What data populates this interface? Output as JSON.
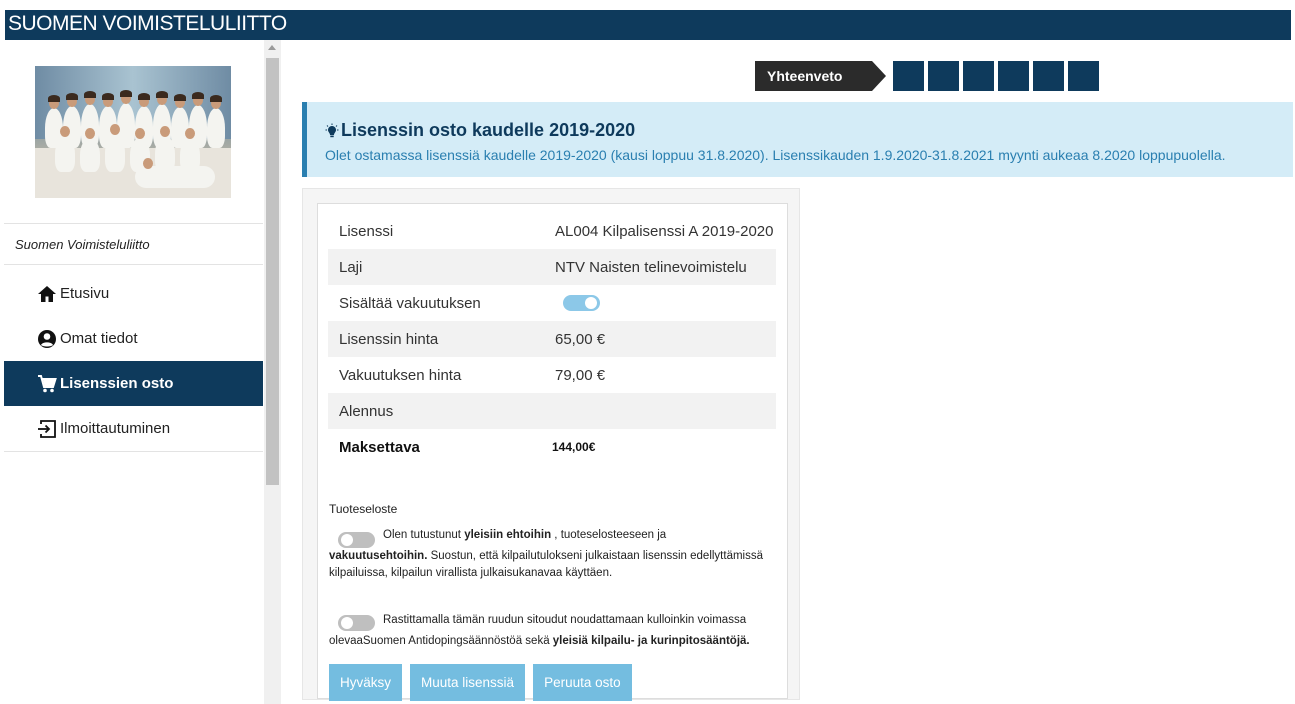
{
  "header": {
    "title": "SUOMEN VOIMISTELULIITTO"
  },
  "sidebar": {
    "org_name": "Suomen Voimisteluliitto",
    "items": [
      {
        "label": "Etusivu",
        "icon": "home-icon",
        "active": false
      },
      {
        "label": "Omat tiedot",
        "icon": "user-circle-icon",
        "active": false
      },
      {
        "label": "Lisenssien osto",
        "icon": "cart-icon",
        "active": true
      },
      {
        "label": "Ilmoittautuminen",
        "icon": "sign-in-icon",
        "active": false
      }
    ]
  },
  "steps": {
    "current": "Yhteenveto",
    "remaining_count": 6
  },
  "alert": {
    "title": "Lisenssin osto kaudelle 2019-2020",
    "message": "Olet ostamassa lisenssiä kaudelle 2019-2020 (kausi loppuu 31.8.2020). Lisenssikauden 1.9.2020-31.8.2021 myynti aukeaa 8.2020 loppupuolella."
  },
  "summary": {
    "rows": [
      {
        "label": "Lisenssi",
        "value": "AL004 Kilpalisenssi A 2019-2020"
      },
      {
        "label": "Laji",
        "value": "NTV Naisten telinevoimistelu"
      },
      {
        "label": "Sisältää vakuutuksen",
        "toggle": true
      },
      {
        "label": "Lisenssin hinta",
        "value": "65,00 €"
      },
      {
        "label": "Vakuutuksen hinta",
        "value": "79,00 €"
      },
      {
        "label": "Alennus",
        "value": ""
      },
      {
        "label": "Maksettava",
        "value": "144,00€"
      }
    ]
  },
  "terms": {
    "heading": "Tuoteseloste",
    "t1_pre": "Olen tutustunut ",
    "t1_link1": "yleisiin ehtoihin",
    "t1_mid": " , tuoteselosteeseen ja",
    "t1_link2": "vakuutusehtoihin.",
    "t1_post": " Suostun, että kilpailutulokseni julkaistaan lisenssin edellyttämissä kilpailuissa, kilpailun virallista julkaisukanavaa käyttäen.",
    "t2_pre": "Rastittamalla tämän ruudun sitoudut noudattamaan kulloinkin voimassa olevaaSuomen Antidopingsäännöstöä sekä ",
    "t2_link": "yleisiä kilpailu- ja kurinpitosääntöjä.",
    "t1_checked": false,
    "t2_checked": false
  },
  "buttons": {
    "accept": "Hyväksy",
    "change": "Muuta lisenssiä",
    "cancel": "Peruuta osto"
  },
  "colors": {
    "brand": "#0e3a5c",
    "accent": "#74bde0",
    "alert_bg": "#d4ecf7",
    "alert_border": "#2a7fb0"
  }
}
